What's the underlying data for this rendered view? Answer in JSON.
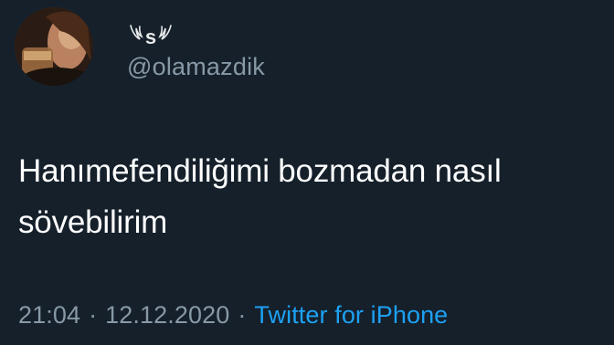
{
  "tweet": {
    "display_name_letter": "s",
    "handle": "@olamazdik",
    "text_lines": [
      "Hanımefendiliğimi bozmadan nasıl",
      "sövebilirim"
    ],
    "time": "21:04",
    "date": "12.12.2020",
    "separator": "·",
    "source": "Twitter for iPhone"
  },
  "colors": {
    "background": "#15202b",
    "text": "#ffffff",
    "secondary": "#8899a6",
    "link": "#1da1f2"
  },
  "icons": {
    "display_name_decoration": "wing-icon"
  }
}
